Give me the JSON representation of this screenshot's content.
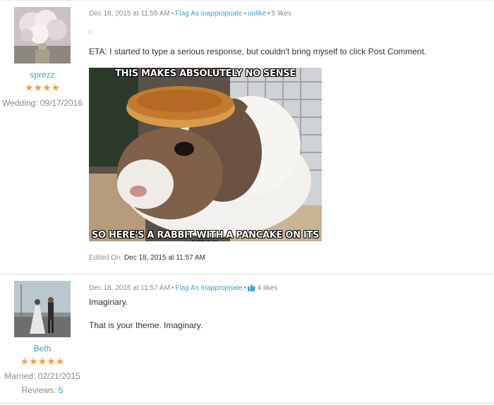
{
  "posts": [
    {
      "user": {
        "name": "sprezz",
        "stars": "★★★★",
        "meta_label": "Wedding: 09/17/2016"
      },
      "header": {
        "date": "Dec 18, 2015 at 11:55 AM",
        "flag": "Flag As Inappropriate",
        "like_action": "unlike",
        "likes": "5 likes"
      },
      "body": [
        ".",
        "ETA: I started to type a serious response, but couldn't bring myself to click Post Comment."
      ],
      "meme": {
        "top_text": "THIS MAKES ABSOLUTELY NO SENSE",
        "bottom_text": "SO HERE'S A RABBIT WITH A PANCAKE ON ITS HEAD"
      },
      "edited": {
        "label": "Edited On:",
        "value": "Dec 18, 2015 at 11:57 AM"
      }
    },
    {
      "user": {
        "name": "Beth",
        "stars": "★★★★★",
        "meta_label": "Married: 02/21/2015",
        "reviews_label": "Reviews:",
        "reviews_count": "5"
      },
      "header": {
        "date": "Dec 18, 2015 at 11:57 AM",
        "flag": "Flag As Inappropriate",
        "likes": "4 likes"
      },
      "body": [
        "Imaginary.",
        "That is your theme. Imaginary."
      ]
    }
  ],
  "colors": {
    "link": "#3aa0c9",
    "star": "#f0a13c",
    "muted": "#8a8a8a"
  }
}
